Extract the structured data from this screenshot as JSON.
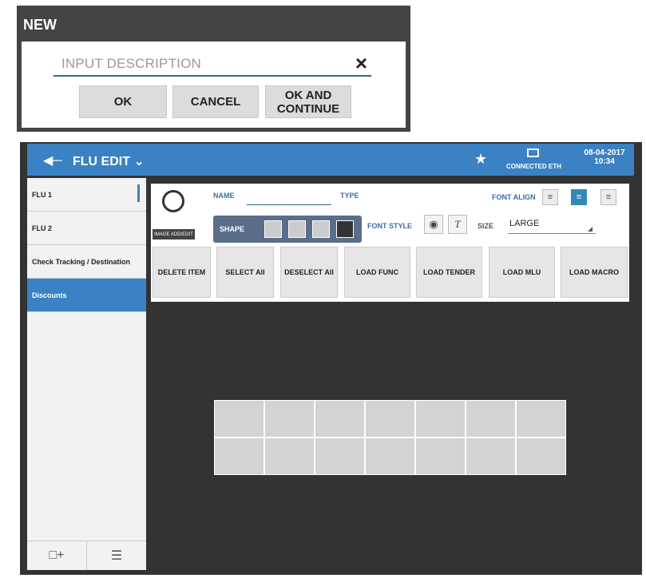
{
  "dialog": {
    "title": "NEW",
    "input_placeholder": "INPUT DESCRIPTION",
    "clear_icon": "×",
    "buttons": {
      "ok": "OK",
      "cancel": "CANCEL",
      "ok_continue_line1": "OK AND",
      "ok_continue_line2": "CONTINUE"
    }
  },
  "topbar": {
    "back_icon": "arrow-left-icon",
    "title": "FLU EDIT ⌄",
    "star_icon": "star-icon",
    "connection": "CONNECTED ETH",
    "date": "08-04-2017",
    "time": "10:34"
  },
  "sidebar": {
    "items": [
      {
        "label": "FLU 1"
      },
      {
        "label": "FLU 2"
      },
      {
        "label": "Check Tracking / Destination"
      },
      {
        "label": "Discounts"
      }
    ],
    "footer": [
      "add-icon",
      "list-icon"
    ]
  },
  "editor": {
    "image_label": "IMAGE ADD/EDIT",
    "name_label": "NAME",
    "type_label": "TYPE",
    "shape_label": "SHAPE",
    "font_align_label": "FONT ALIGN",
    "font_style_label": "FONT STYLE",
    "size_label": "SIZE",
    "size_value": "LARGE",
    "font_style_t": "T"
  },
  "toolbar": {
    "delete_item": "DELETE ITEM",
    "select_all": "SELECT All",
    "deselect_all": "DESELECT All",
    "load_func": "LOAD FUNC",
    "load_tender": "LOAD TENDER",
    "load_mlu": "LOAD MLU",
    "load_macro": "LOAD MACRO"
  },
  "colors": {
    "accent": "#3a82c4",
    "dark_bg": "#333333",
    "align_active": "#2e8ab8"
  }
}
